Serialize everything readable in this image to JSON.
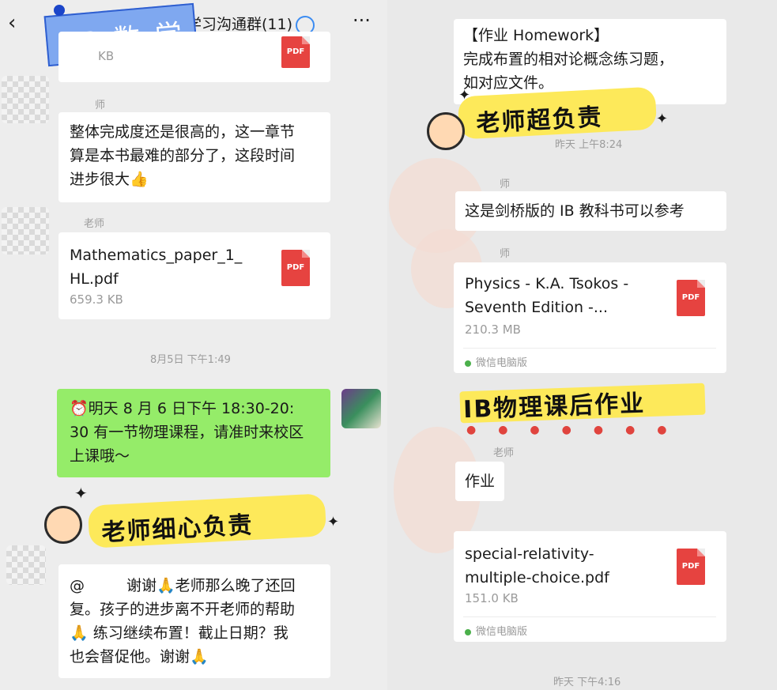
{
  "header": {
    "back_icon": "chevron-left-icon",
    "title_fragment": "学习沟通群(11)",
    "more_icon": "ellipsis-icon",
    "sticker_label": "IB 数 学"
  },
  "left": {
    "top_file": {
      "size_fragment": "KB",
      "icon": "pdf-icon",
      "icon_label": "PDF"
    },
    "msg1": {
      "sender": "师",
      "text": "整体完成度还是很高的，这一章节\n算是本书最难的部分了，这段时间\n进步很大👍"
    },
    "msg2": {
      "sender": "老师",
      "file_name": "Mathematics_paper_1_\nHL.pdf",
      "file_size": "659.3 KB",
      "icon_label": "PDF"
    },
    "timestamp1": "8月5日 下午1:49",
    "msg3": {
      "text": "⏰明天 8 月 6 日下午 18:30-20:\n30 有一节物理课程，请准时来校区\n上课哦～"
    },
    "sticker2": "老师细心负责",
    "msg4": {
      "text_prefix": "@",
      "text": "谢谢🙏老师那么晚了还回\n复。孩子的进步离不开老师的帮助\n🙏 练习继续布置！截止日期？我\n也会督促他。谢谢🙏"
    }
  },
  "right": {
    "msg1": {
      "text": "【作业 Homework】\n  完成布置的相对论概念练习题，\n如对应文件。"
    },
    "sticker1": "老师超负责",
    "timestamp1": "昨天 上午8:24",
    "msg2": {
      "sender": "师",
      "text": "这是剑桥版的 IB 教科书可以参考"
    },
    "msg3": {
      "sender": "师",
      "file_name": "Physics - K.A. Tsokos -\nSeventh Edition -...",
      "file_size": "210.3 MB",
      "source": "微信电脑版",
      "icon_label": "PDF"
    },
    "sticker2": "IB物理课后作业",
    "msg4": {
      "sender": "老师",
      "text": "作业"
    },
    "msg5": {
      "file_name": "special-relativity-\nmultiple-choice.pdf",
      "file_size": "151.0 KB",
      "source": "微信电脑版",
      "icon_label": "PDF"
    },
    "timestamp2": "昨天 下午4:16"
  },
  "colors": {
    "green_bubble": "#95ec69",
    "sticker_yellow": "#fde95a",
    "pdf_red": "#e64340",
    "background": "#ededed"
  }
}
